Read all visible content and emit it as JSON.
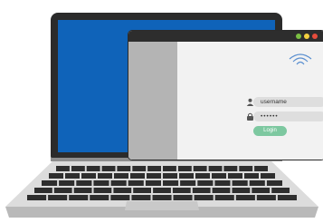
{
  "login": {
    "username_label": "username",
    "password_mask": "••••••",
    "login_button_label": "Login"
  },
  "icons": {
    "wifi": "wifi-icon",
    "user": "user-icon",
    "lock": "lock-icon"
  },
  "colors": {
    "screen_blue": "#0f63b9",
    "bezel_dark": "#2b2b2b",
    "sidebar_gray": "#b4b4b4",
    "button_green": "#7dc8a0",
    "dot_green": "#7bc043",
    "dot_yellow": "#f4d03f",
    "dot_red": "#e74c3c"
  }
}
